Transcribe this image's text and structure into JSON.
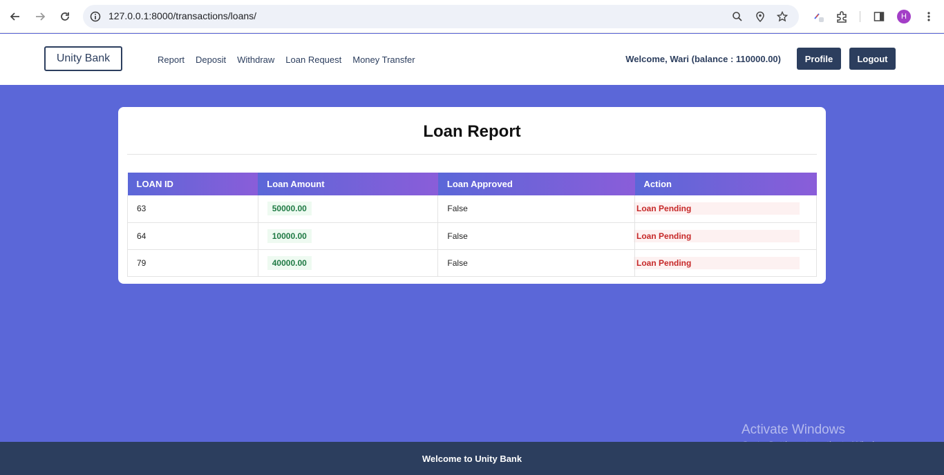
{
  "browser": {
    "url": "127.0.0.1:8000/transactions/loans/",
    "profile_initial": "H"
  },
  "header": {
    "brand": "Unity Bank",
    "nav": [
      "Report",
      "Deposit",
      "Withdraw",
      "Loan Request",
      "Money Transfer"
    ],
    "welcome": "Welcome, Wari (balance : 110000.00)",
    "profile_label": "Profile",
    "logout_label": "Logout"
  },
  "report": {
    "title": "Loan Report",
    "columns": [
      "LOAN ID",
      "Loan Amount",
      "Loan Approved",
      "Action"
    ],
    "rows": [
      {
        "id": "63",
        "amount": "50000.00",
        "approved": "False",
        "action": "Loan Pending"
      },
      {
        "id": "64",
        "amount": "10000.00",
        "approved": "False",
        "action": "Loan Pending"
      },
      {
        "id": "79",
        "amount": "40000.00",
        "approved": "False",
        "action": "Loan Pending"
      }
    ]
  },
  "footer": {
    "text": "Welcome to Unity Bank"
  },
  "watermark": {
    "line1": "Activate Windows",
    "line2": "Go to Settings to activate Windows."
  },
  "colors": {
    "background": "#5b67d8",
    "navy": "#2c3e5e",
    "amount_green": "#1f7a44",
    "pending_red": "#c62828"
  }
}
